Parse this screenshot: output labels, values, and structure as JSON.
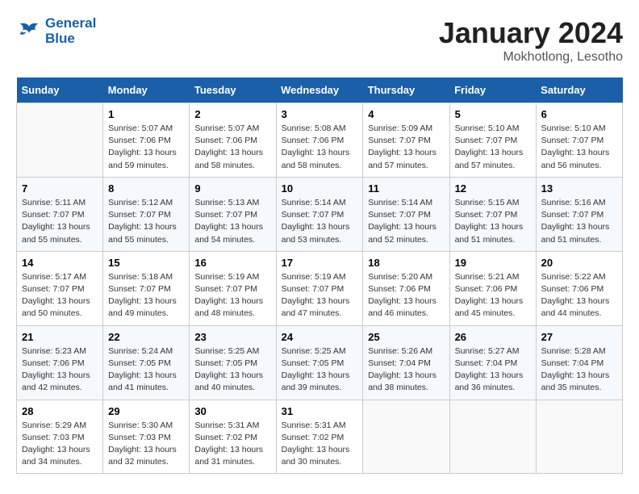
{
  "header": {
    "logo_line1": "General",
    "logo_line2": "Blue",
    "title": "January 2024",
    "subtitle": "Mokhotlong, Lesotho"
  },
  "columns": [
    "Sunday",
    "Monday",
    "Tuesday",
    "Wednesday",
    "Thursday",
    "Friday",
    "Saturday"
  ],
  "weeks": [
    [
      {
        "day": "",
        "sunrise": "",
        "sunset": "",
        "daylight": ""
      },
      {
        "day": "1",
        "sunrise": "Sunrise: 5:07 AM",
        "sunset": "Sunset: 7:06 PM",
        "daylight": "Daylight: 13 hours and 59 minutes."
      },
      {
        "day": "2",
        "sunrise": "Sunrise: 5:07 AM",
        "sunset": "Sunset: 7:06 PM",
        "daylight": "Daylight: 13 hours and 58 minutes."
      },
      {
        "day": "3",
        "sunrise": "Sunrise: 5:08 AM",
        "sunset": "Sunset: 7:06 PM",
        "daylight": "Daylight: 13 hours and 58 minutes."
      },
      {
        "day": "4",
        "sunrise": "Sunrise: 5:09 AM",
        "sunset": "Sunset: 7:07 PM",
        "daylight": "Daylight: 13 hours and 57 minutes."
      },
      {
        "day": "5",
        "sunrise": "Sunrise: 5:10 AM",
        "sunset": "Sunset: 7:07 PM",
        "daylight": "Daylight: 13 hours and 57 minutes."
      },
      {
        "day": "6",
        "sunrise": "Sunrise: 5:10 AM",
        "sunset": "Sunset: 7:07 PM",
        "daylight": "Daylight: 13 hours and 56 minutes."
      }
    ],
    [
      {
        "day": "7",
        "sunrise": "Sunrise: 5:11 AM",
        "sunset": "Sunset: 7:07 PM",
        "daylight": "Daylight: 13 hours and 55 minutes."
      },
      {
        "day": "8",
        "sunrise": "Sunrise: 5:12 AM",
        "sunset": "Sunset: 7:07 PM",
        "daylight": "Daylight: 13 hours and 55 minutes."
      },
      {
        "day": "9",
        "sunrise": "Sunrise: 5:13 AM",
        "sunset": "Sunset: 7:07 PM",
        "daylight": "Daylight: 13 hours and 54 minutes."
      },
      {
        "day": "10",
        "sunrise": "Sunrise: 5:14 AM",
        "sunset": "Sunset: 7:07 PM",
        "daylight": "Daylight: 13 hours and 53 minutes."
      },
      {
        "day": "11",
        "sunrise": "Sunrise: 5:14 AM",
        "sunset": "Sunset: 7:07 PM",
        "daylight": "Daylight: 13 hours and 52 minutes."
      },
      {
        "day": "12",
        "sunrise": "Sunrise: 5:15 AM",
        "sunset": "Sunset: 7:07 PM",
        "daylight": "Daylight: 13 hours and 51 minutes."
      },
      {
        "day": "13",
        "sunrise": "Sunrise: 5:16 AM",
        "sunset": "Sunset: 7:07 PM",
        "daylight": "Daylight: 13 hours and 51 minutes."
      }
    ],
    [
      {
        "day": "14",
        "sunrise": "Sunrise: 5:17 AM",
        "sunset": "Sunset: 7:07 PM",
        "daylight": "Daylight: 13 hours and 50 minutes."
      },
      {
        "day": "15",
        "sunrise": "Sunrise: 5:18 AM",
        "sunset": "Sunset: 7:07 PM",
        "daylight": "Daylight: 13 hours and 49 minutes."
      },
      {
        "day": "16",
        "sunrise": "Sunrise: 5:19 AM",
        "sunset": "Sunset: 7:07 PM",
        "daylight": "Daylight: 13 hours and 48 minutes."
      },
      {
        "day": "17",
        "sunrise": "Sunrise: 5:19 AM",
        "sunset": "Sunset: 7:07 PM",
        "daylight": "Daylight: 13 hours and 47 minutes."
      },
      {
        "day": "18",
        "sunrise": "Sunrise: 5:20 AM",
        "sunset": "Sunset: 7:06 PM",
        "daylight": "Daylight: 13 hours and 46 minutes."
      },
      {
        "day": "19",
        "sunrise": "Sunrise: 5:21 AM",
        "sunset": "Sunset: 7:06 PM",
        "daylight": "Daylight: 13 hours and 45 minutes."
      },
      {
        "day": "20",
        "sunrise": "Sunrise: 5:22 AM",
        "sunset": "Sunset: 7:06 PM",
        "daylight": "Daylight: 13 hours and 44 minutes."
      }
    ],
    [
      {
        "day": "21",
        "sunrise": "Sunrise: 5:23 AM",
        "sunset": "Sunset: 7:06 PM",
        "daylight": "Daylight: 13 hours and 42 minutes."
      },
      {
        "day": "22",
        "sunrise": "Sunrise: 5:24 AM",
        "sunset": "Sunset: 7:05 PM",
        "daylight": "Daylight: 13 hours and 41 minutes."
      },
      {
        "day": "23",
        "sunrise": "Sunrise: 5:25 AM",
        "sunset": "Sunset: 7:05 PM",
        "daylight": "Daylight: 13 hours and 40 minutes."
      },
      {
        "day": "24",
        "sunrise": "Sunrise: 5:25 AM",
        "sunset": "Sunset: 7:05 PM",
        "daylight": "Daylight: 13 hours and 39 minutes."
      },
      {
        "day": "25",
        "sunrise": "Sunrise: 5:26 AM",
        "sunset": "Sunset: 7:04 PM",
        "daylight": "Daylight: 13 hours and 38 minutes."
      },
      {
        "day": "26",
        "sunrise": "Sunrise: 5:27 AM",
        "sunset": "Sunset: 7:04 PM",
        "daylight": "Daylight: 13 hours and 36 minutes."
      },
      {
        "day": "27",
        "sunrise": "Sunrise: 5:28 AM",
        "sunset": "Sunset: 7:04 PM",
        "daylight": "Daylight: 13 hours and 35 minutes."
      }
    ],
    [
      {
        "day": "28",
        "sunrise": "Sunrise: 5:29 AM",
        "sunset": "Sunset: 7:03 PM",
        "daylight": "Daylight: 13 hours and 34 minutes."
      },
      {
        "day": "29",
        "sunrise": "Sunrise: 5:30 AM",
        "sunset": "Sunset: 7:03 PM",
        "daylight": "Daylight: 13 hours and 32 minutes."
      },
      {
        "day": "30",
        "sunrise": "Sunrise: 5:31 AM",
        "sunset": "Sunset: 7:02 PM",
        "daylight": "Daylight: 13 hours and 31 minutes."
      },
      {
        "day": "31",
        "sunrise": "Sunrise: 5:31 AM",
        "sunset": "Sunset: 7:02 PM",
        "daylight": "Daylight: 13 hours and 30 minutes."
      },
      {
        "day": "",
        "sunrise": "",
        "sunset": "",
        "daylight": ""
      },
      {
        "day": "",
        "sunrise": "",
        "sunset": "",
        "daylight": ""
      },
      {
        "day": "",
        "sunrise": "",
        "sunset": "",
        "daylight": ""
      }
    ]
  ]
}
